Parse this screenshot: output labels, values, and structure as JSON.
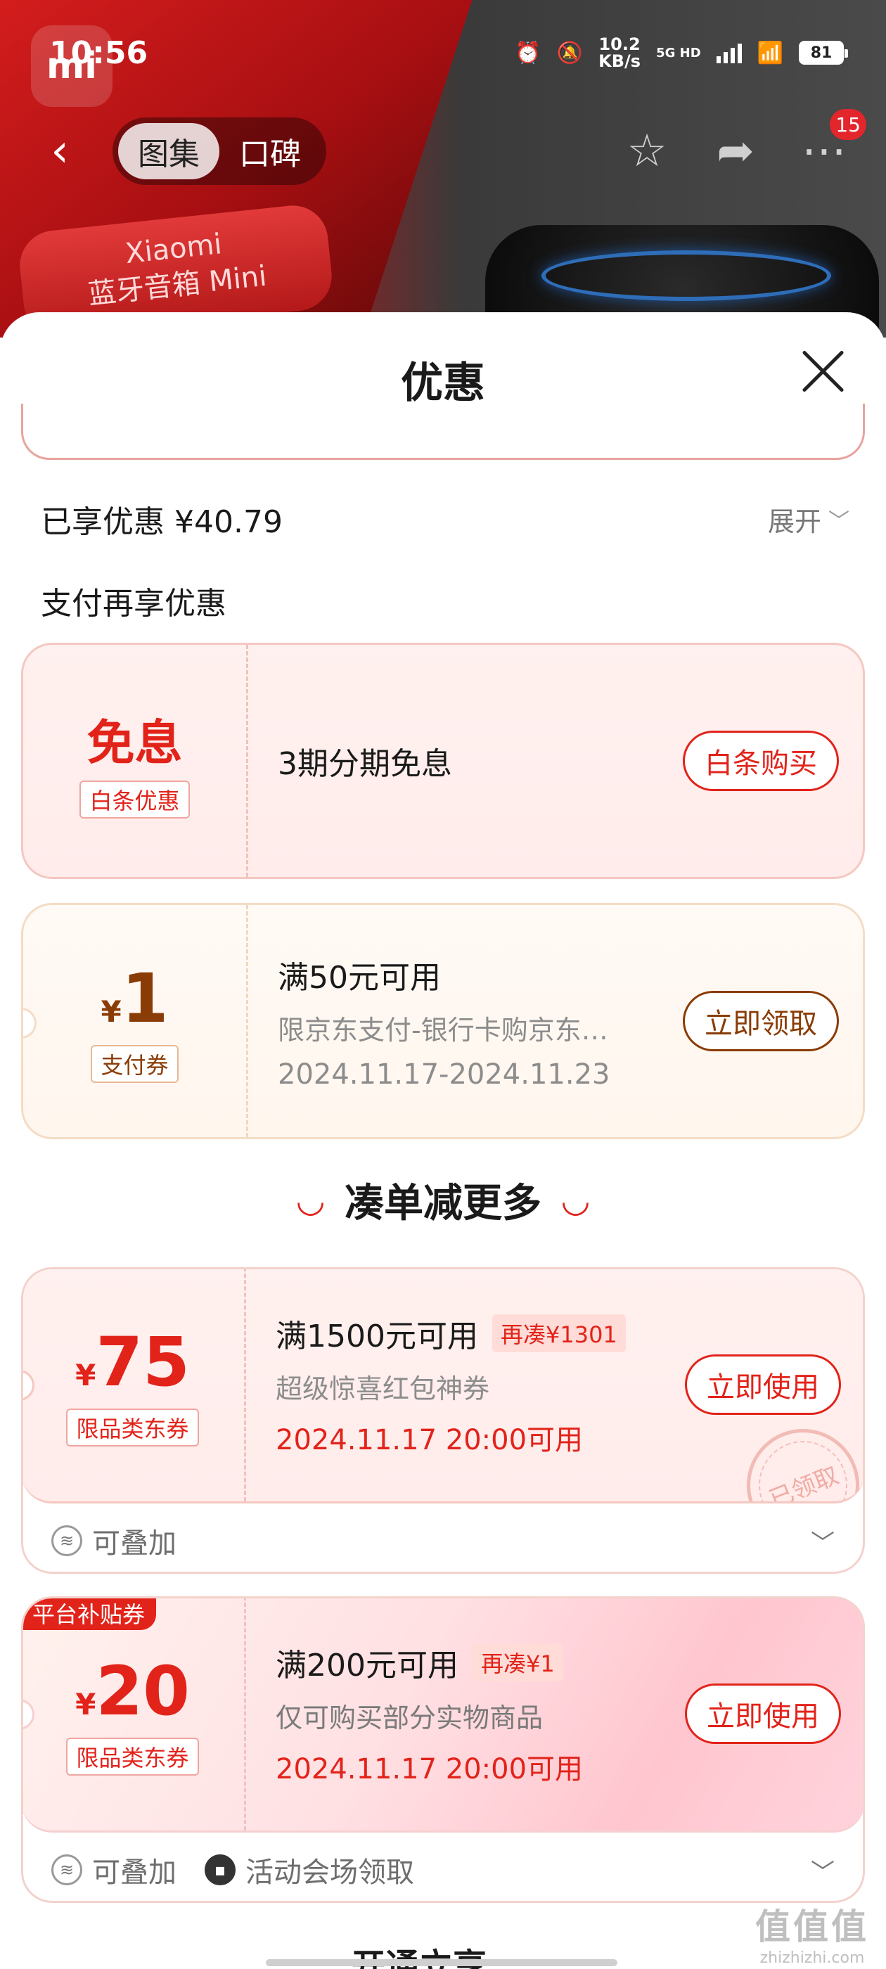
{
  "status_bar": {
    "time": "10:56",
    "speed_value": "10.2",
    "speed_unit": "KB/s",
    "network": "5G HD",
    "battery": "81"
  },
  "header": {
    "tabs": [
      {
        "label": "图集",
        "active": true
      },
      {
        "label": "口碑",
        "active": false
      }
    ],
    "more_badge": "15",
    "product_badge_line1": "Xiaomi",
    "product_badge_line2": "蓝牙音箱 Mini"
  },
  "sheet": {
    "title": "优惠",
    "enjoyed": "已享优惠 ¥40.79",
    "expand_label": "展开",
    "pay_section_label": "支付再享优惠",
    "pay_coupons": [
      {
        "headline": "免息",
        "tag": "白条优惠",
        "main": "3期分期免息",
        "button": "白条购买"
      },
      {
        "currency": "¥",
        "amount": "1",
        "tag": "支付券",
        "main": "满50元可用",
        "sub": "限京东支付-银行卡购京东…",
        "date": "2024.11.17-2024.11.23",
        "button": "立即领取"
      }
    ],
    "more_section_title": "凑单减更多",
    "more_coupons": [
      {
        "currency": "¥",
        "amount": "75",
        "tag": "限品类东券",
        "main": "满1500元可用",
        "chip": "再凑¥1301",
        "sub": "超级惊喜红包神券",
        "date": "2024.11.17 20:00可用",
        "button": "立即使用",
        "stamp": "已领取",
        "footer_stackable": "可叠加"
      },
      {
        "platform_label": "平台补贴券",
        "currency": "¥",
        "amount": "20",
        "tag": "限品类东券",
        "main": "满200元可用",
        "chip": "再凑¥1",
        "sub": "仅可购买部分实物商品",
        "date": "2024.11.17 20:00可用",
        "button": "立即使用",
        "footer_stackable": "可叠加",
        "footer_venue": "活动会场领取"
      }
    ],
    "peek_next_section": "开通立享"
  },
  "watermark": {
    "big": "值值值",
    "small": "zhizhizhi.com"
  },
  "colors": {
    "accent_red": "#e2231a",
    "gold_brown": "#8a3c06"
  }
}
